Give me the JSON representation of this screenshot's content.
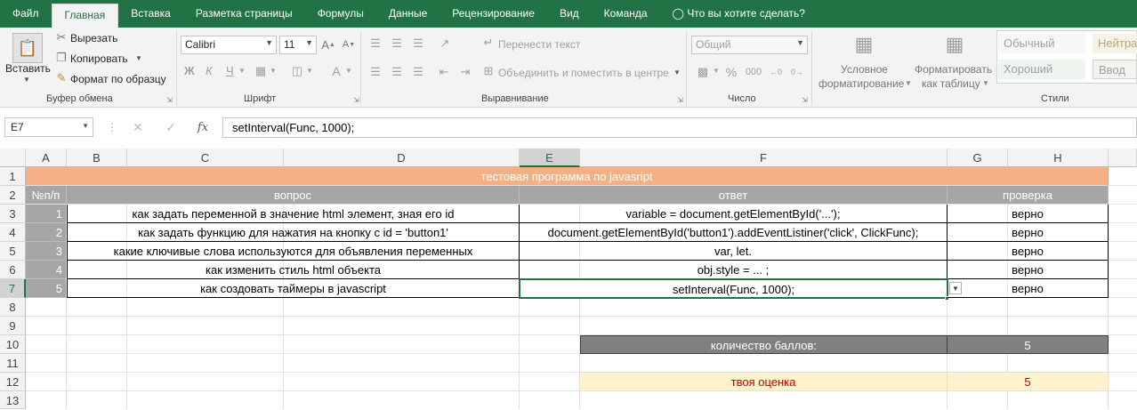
{
  "tabs": [
    "Файл",
    "Главная",
    "Вставка",
    "Разметка страницы",
    "Формулы",
    "Данные",
    "Рецензирование",
    "Вид",
    "Команда",
    "Что вы хотите сделать?"
  ],
  "clipboard": {
    "paste": "Вставить",
    "cut": "Вырезать",
    "copy": "Копировать",
    "format_painter": "Формат по образцу",
    "label": "Буфер обмена"
  },
  "font": {
    "name": "Calibri",
    "size": "11",
    "label": "Шрифт",
    "bold": "Ж",
    "italic": "К",
    "underline": "Ч"
  },
  "alignment": {
    "wrap": "Перенести текст",
    "merge": "Объединить и поместить в центре",
    "label": "Выравнивание"
  },
  "number": {
    "format": "Общий",
    "label": "Число"
  },
  "styles": {
    "cond_line1": "Условное",
    "cond_line2": "форматирование",
    "table_line1": "Форматировать",
    "table_line2": "как таблицу",
    "normal": "Обычный",
    "neutral": "Нейтра",
    "good": "Хороший",
    "input": "Ввод",
    "label": "Стили"
  },
  "formula_bar": {
    "name_box": "E7",
    "fx": "fx",
    "formula": "setInterval(Func, 1000);"
  },
  "columns": [
    "A",
    "B",
    "C",
    "D",
    "E",
    "F",
    "G",
    "H"
  ],
  "rows": [
    "1",
    "2",
    "3",
    "4",
    "5",
    "6",
    "7",
    "8",
    "9",
    "10",
    "11",
    "12",
    "13"
  ],
  "sheet": {
    "title": "тестовая программа по javasript",
    "hdr_num": "№п/п",
    "hdr_question": "вопрос",
    "hdr_answer": "ответ",
    "hdr_check": "проверка",
    "items": [
      {
        "n": "1",
        "q": "как задать переменной в значение html элемент, зная его id",
        "a": "variable = document.getElementById('...');",
        "c": "верно"
      },
      {
        "n": "2",
        "q": "как задать функцию для нажатия на кнопку с id = 'button1'",
        "a": "document.getElementById('button1').addEventListiner('click', ClickFunc);",
        "c": "верно"
      },
      {
        "n": "3",
        "q": "какие ключивые слова используются для объявления переменных",
        "a": "var, let.",
        "c": "верно"
      },
      {
        "n": "4",
        "q": "как изменить стиль html объекта",
        "a": "obj.style = ... ;",
        "c": "верно"
      },
      {
        "n": "5",
        "q": "как создовать таймеры в javascript",
        "a": "setInterval(Func, 1000);",
        "c": "верно"
      }
    ],
    "score_label": "количество баллов:",
    "score_value": "5",
    "grade_label": "твоя оценка",
    "grade_value": "5"
  },
  "colors": {
    "ribbon_green": "#217346",
    "title_fill": "#f4b084",
    "header_fill": "#a6a6a6",
    "score_fill": "#808080",
    "grade_fill": "#fff2cc",
    "grade_text": "#c00000"
  }
}
